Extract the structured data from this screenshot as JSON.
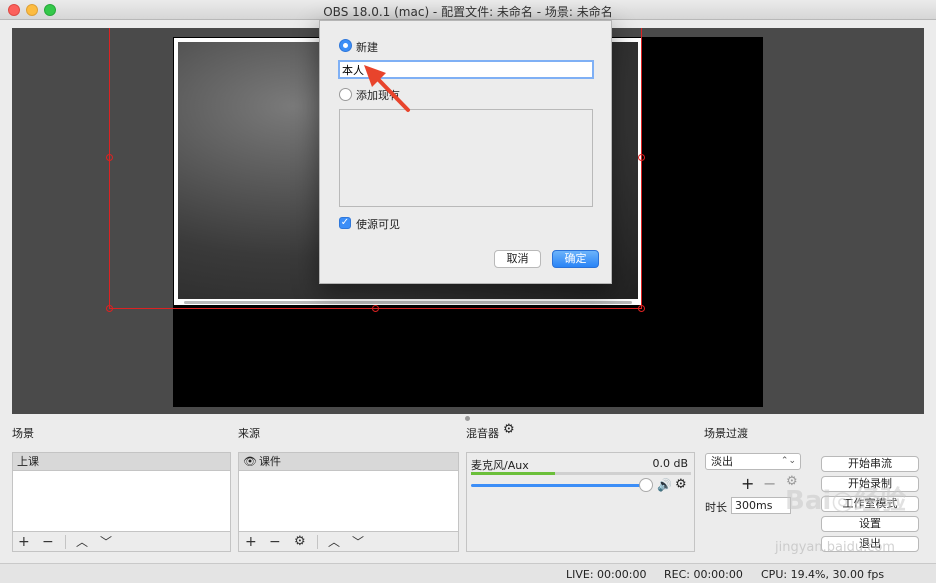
{
  "window": {
    "title": "OBS 18.0.1 (mac) - 配置文件: 未命名 - 场景: 未命名"
  },
  "dialog": {
    "radio_new": "新建",
    "name_value": "本人",
    "radio_existing": "添加现有",
    "checkbox_visible": "使源可见",
    "cancel": "取消",
    "ok": "确定"
  },
  "docks": {
    "scenes": {
      "title": "场景",
      "items": [
        "上课"
      ]
    },
    "sources": {
      "title": "来源",
      "items": [
        "课件"
      ]
    },
    "mixer": {
      "title": "混音器",
      "channel": "麦克风/Aux",
      "level": "0.0 dB"
    },
    "transitions": {
      "title": "场景过渡",
      "selected": "淡出",
      "duration_label": "时长",
      "duration_value": "300ms"
    }
  },
  "controls": {
    "start_stream": "开始串流",
    "start_record": "开始录制",
    "studio_mode": "工作室模式",
    "settings": "设置",
    "exit": "退出"
  },
  "status": {
    "live": "LIVE: 00:00:00",
    "rec": "REC: 00:00:00",
    "cpu": "CPU: 19.4%, 30.00 fps"
  },
  "watermark": {
    "brand": "Baidu 经验",
    "url": "jingyan.baidu.com"
  },
  "colors": {
    "accent": "#3c8ef7",
    "selection": "#dd2222",
    "arrow": "#e8442c"
  }
}
